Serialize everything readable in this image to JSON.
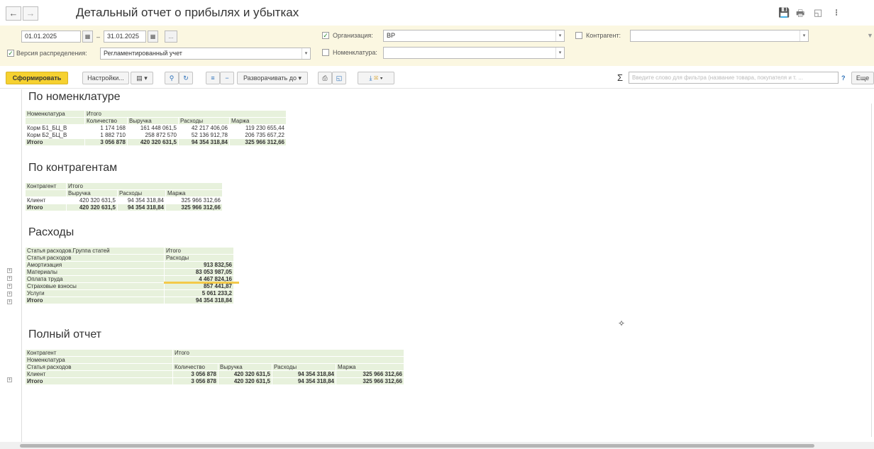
{
  "window": {
    "title": "Детальный отчет о прибылях и убытках",
    "back_icon": "arrow-left",
    "forward_icon": "arrow-right",
    "more_icon": "⁝"
  },
  "filters": {
    "date_from": "01.01.2025",
    "date_sep": "–",
    "date_to": "31.01.2025",
    "period_btn": "...",
    "org_label": "Организация:",
    "org_value": "ВР",
    "counterparty_label": "Контрагент:",
    "counterparty_value": "",
    "version_label": "Версия распределения:",
    "version_value": "Регламентированный учет",
    "nomenclature_label": "Номенклатура:",
    "nomenclature_value": ""
  },
  "toolbar": {
    "generate": "Сформировать",
    "settings": "Настройки...",
    "expand_to": "Разворачивать до",
    "search_placeholder": "Введите слово для фильтра (название товара, покупателя и т. ...",
    "help": "?",
    "more": "Еще"
  },
  "sections": {
    "nomenclature": {
      "title": "По номенклатуре",
      "head1": [
        "Номенклатура",
        "Итого"
      ],
      "head2": [
        "Количество",
        "Выручка",
        "Расходы",
        "Маржа"
      ],
      "rows": [
        [
          "Корм Б1_БЦ_В",
          "1 174 168",
          "161 448 061,5",
          "42 217 406,06",
          "119 230 655,44"
        ],
        [
          "Корм Б2_БЦ_В",
          "1 882 710",
          "258 872 570",
          "52 136 912,78",
          "206 735 657,22"
        ]
      ],
      "total": [
        "Итого",
        "3 056 878",
        "420 320 631,5",
        "94 354 318,84",
        "325 966 312,66"
      ]
    },
    "counterparty": {
      "title": "По контрагентам",
      "head1": [
        "Контрагент",
        "Итого"
      ],
      "head2": [
        "Выручка",
        "Расходы",
        "Маржа"
      ],
      "rows": [
        [
          "Клиент",
          "420 320 631,5",
          "94 354 318,84",
          "325 966 312,66"
        ]
      ],
      "total": [
        "Итого",
        "420 320 631,5",
        "94 354 318,84",
        "325 966 312,66"
      ]
    },
    "expenses": {
      "title": "Расходы",
      "head1": [
        "Статья расходов.Группа статей",
        "Итого"
      ],
      "head2": [
        "Статья расходов",
        "Расходы"
      ],
      "rows": [
        [
          "Амортизация",
          "913 832,56"
        ],
        [
          "Материалы",
          "83 053 987,05"
        ],
        [
          "Оплата труда",
          "4 467 824,16"
        ],
        [
          "Страховые взносы",
          "857 441,87"
        ],
        [
          "Услуги",
          "5 061 233,2"
        ]
      ],
      "total": [
        "Итого",
        "94 354 318,84"
      ]
    },
    "full": {
      "title": "Полный отчет",
      "head1": [
        "Контрагент",
        "Итого"
      ],
      "head_mid": "Номенклатура",
      "head2": [
        "Статья расходов",
        "Количество",
        "Выручка",
        "Расходы",
        "Маржа"
      ],
      "rows": [
        [
          "Клиент",
          "3 056 878",
          "420 320 631,5",
          "94 354 318,84",
          "325 966 312,66"
        ]
      ],
      "total": [
        "Итого",
        "3 056 878",
        "420 320 631,5",
        "94 354 318,84",
        "325 966 312,66"
      ]
    }
  }
}
